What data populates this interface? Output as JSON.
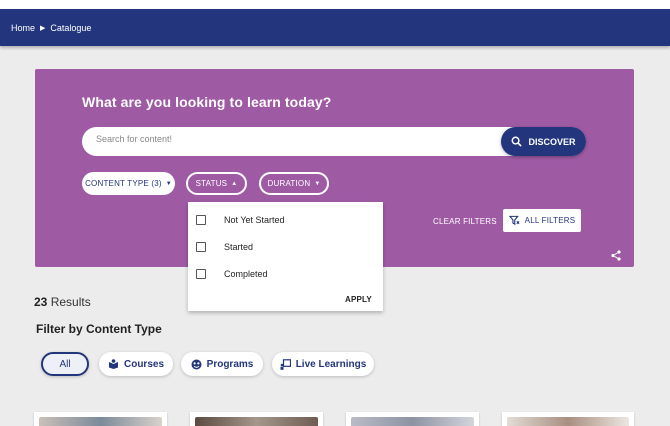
{
  "breadcrumb": {
    "home": "Home",
    "separator": "▶",
    "current": "Catalogue"
  },
  "hero": {
    "title": "What are you looking to learn today?",
    "search_placeholder": "Search for content!",
    "discover_label": "DISCOVER",
    "filters": {
      "content_type": "CONTENT TYPE (3)",
      "status": "STATUS",
      "duration": "DURATION"
    },
    "clear_filters": "CLEAR FILTERS",
    "all_filters": "ALL FILTERS"
  },
  "status_dropdown": {
    "options": [
      "Not Yet Started",
      "Started",
      "Completed"
    ],
    "apply_label": "APPLY"
  },
  "results": {
    "count": "23",
    "label": "Results"
  },
  "content_filter": {
    "title": "Filter by Content Type",
    "pills": [
      "All",
      "Courses",
      "Programs",
      "Live Learnings"
    ]
  },
  "colors": {
    "navy": "#23357c",
    "purple": "#9e5ba4",
    "background": "#ececec"
  },
  "icons": [
    "search-icon",
    "filter-icon",
    "share-icon",
    "courses-icon",
    "programs-icon",
    "live-learnings-icon"
  ]
}
